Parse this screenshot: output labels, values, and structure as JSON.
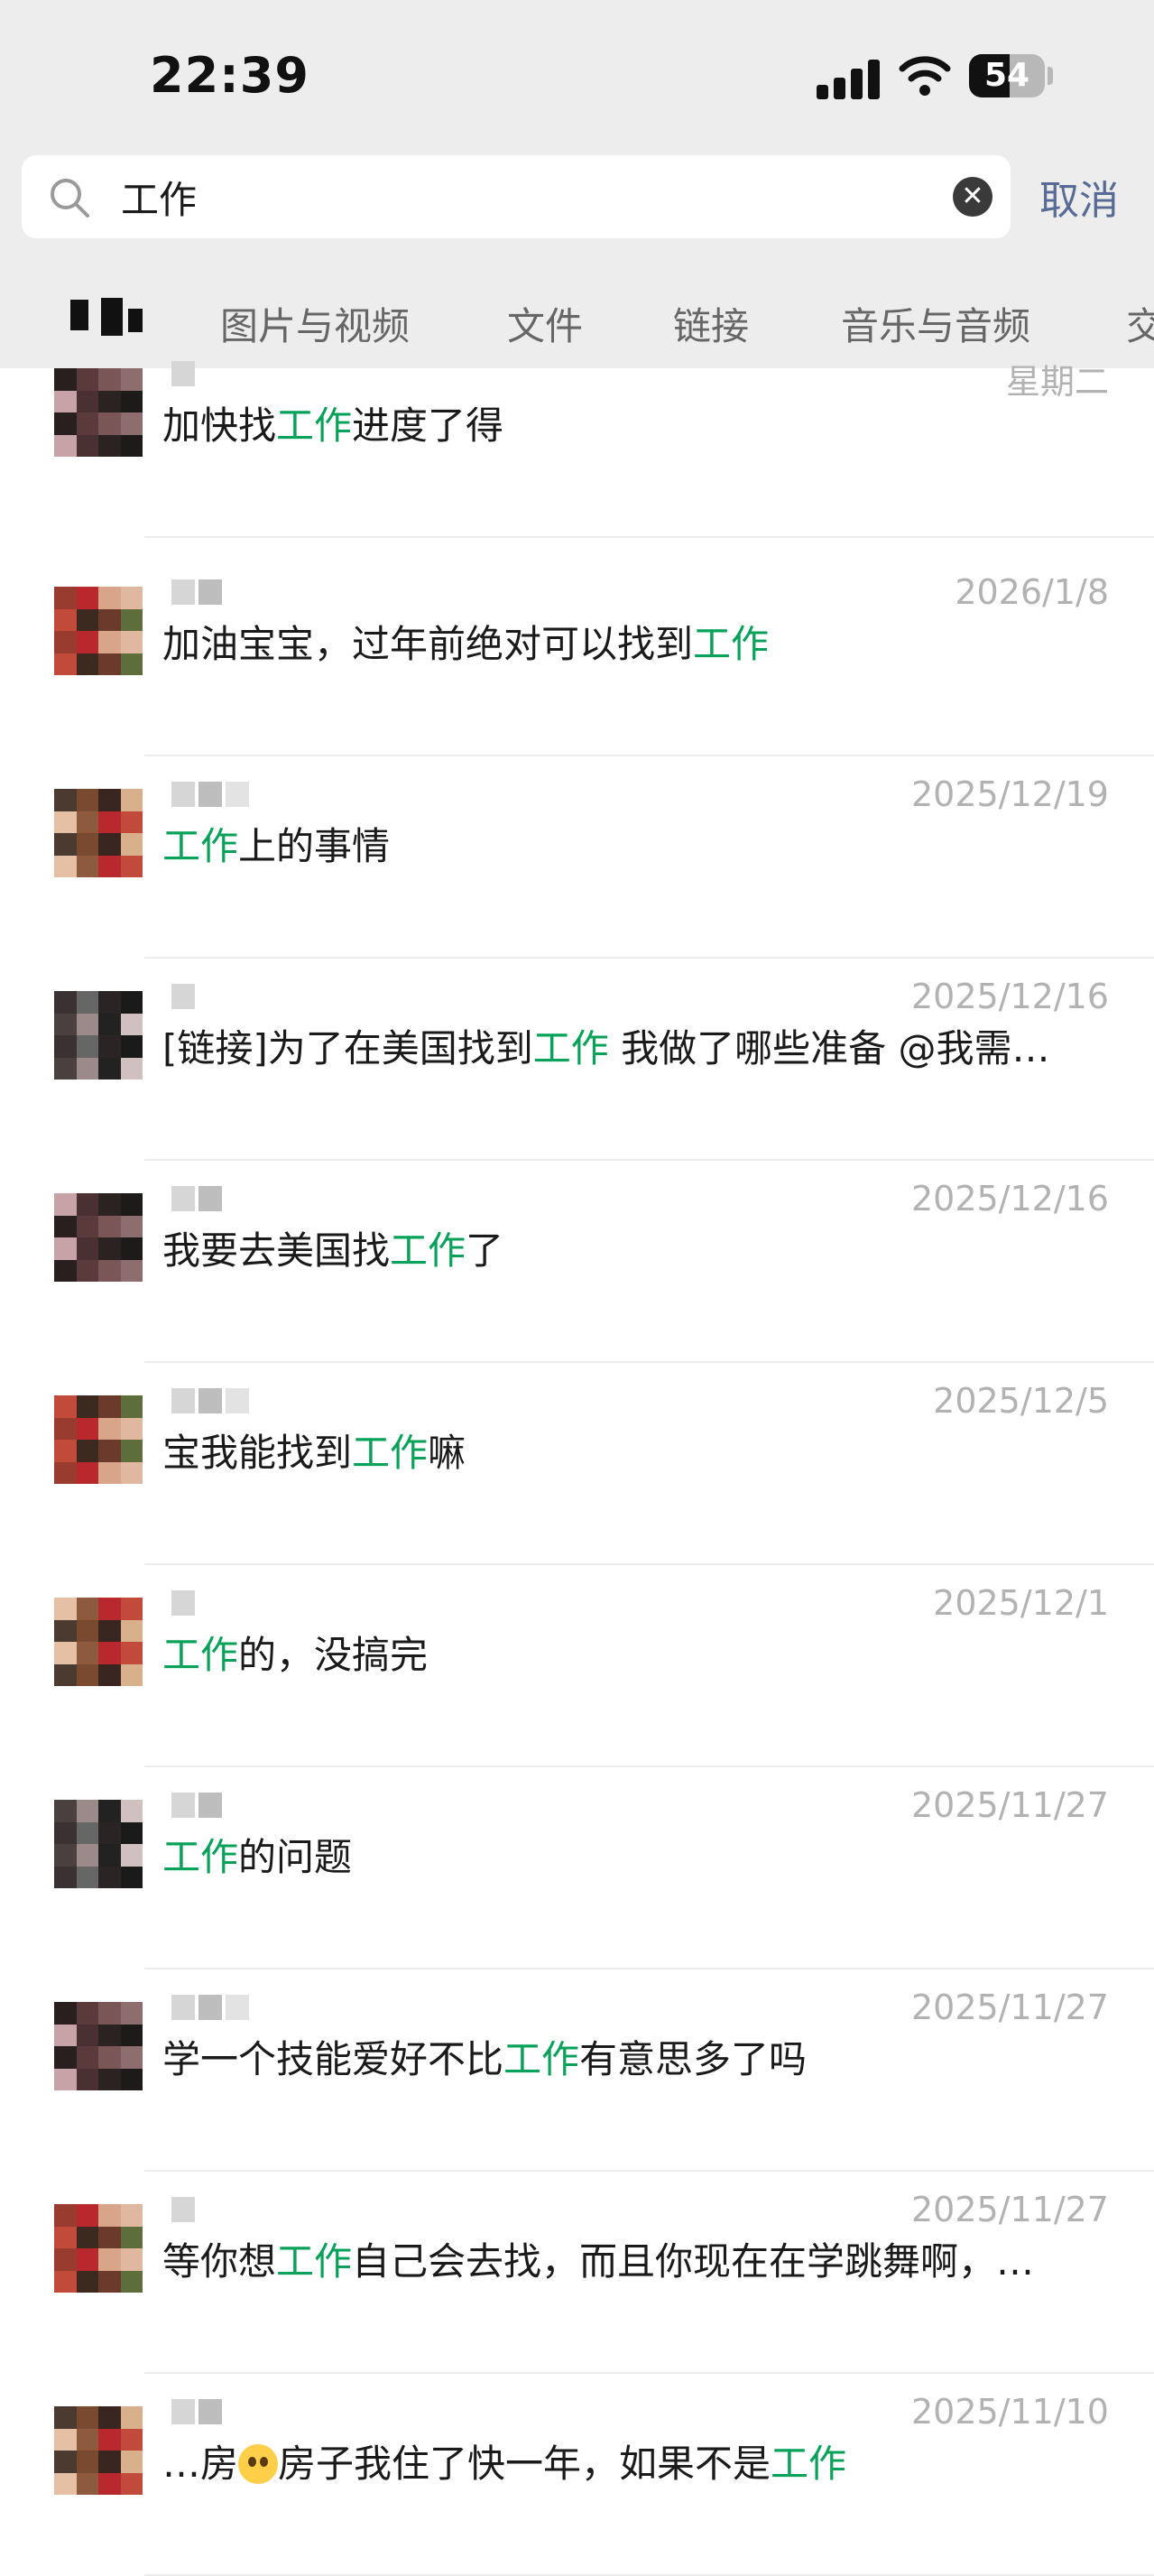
{
  "status_bar": {
    "time": "22:39",
    "battery": "54"
  },
  "search": {
    "query": "工作",
    "cancel_label": "取消"
  },
  "tabs": [
    "图片与视频",
    "文件",
    "链接",
    "音乐与音频",
    "交"
  ],
  "results": [
    {
      "date": "星期二",
      "parts": [
        {
          "t": "加快找"
        },
        {
          "t": "工作",
          "hl": true
        },
        {
          "t": "进度了得"
        }
      ]
    },
    {
      "date": "2026/1/8",
      "parts": [
        {
          "t": "加油宝宝，过年前绝对可以找到"
        },
        {
          "t": "工作",
          "hl": true
        }
      ]
    },
    {
      "date": "2025/12/19",
      "parts": [
        {
          "t": "工作",
          "hl": true
        },
        {
          "t": "上的事情"
        }
      ]
    },
    {
      "date": "2025/12/16",
      "parts": [
        {
          "t": "[链接]为了在美国找到"
        },
        {
          "t": "工作",
          "hl": true
        },
        {
          "t": " 我做了哪些准备 @我需…"
        }
      ]
    },
    {
      "date": "2025/12/16",
      "parts": [
        {
          "t": "我要去美国找"
        },
        {
          "t": "工作",
          "hl": true
        },
        {
          "t": "了"
        }
      ]
    },
    {
      "date": "2025/12/5",
      "parts": [
        {
          "t": "宝我能找到"
        },
        {
          "t": "工作",
          "hl": true
        },
        {
          "t": "嘛"
        }
      ]
    },
    {
      "date": "2025/12/1",
      "parts": [
        {
          "t": "工作",
          "hl": true
        },
        {
          "t": "的，没搞完"
        }
      ]
    },
    {
      "date": "2025/11/27",
      "parts": [
        {
          "t": "工作",
          "hl": true
        },
        {
          "t": "的问题"
        }
      ]
    },
    {
      "date": "2025/11/27",
      "parts": [
        {
          "t": "学一个技能爱好不比"
        },
        {
          "t": "工作",
          "hl": true
        },
        {
          "t": "有意思多了吗"
        }
      ]
    },
    {
      "date": "2025/11/27",
      "parts": [
        {
          "t": "等你想"
        },
        {
          "t": "工作",
          "hl": true
        },
        {
          "t": "自己会去找，而且你现在在学跳舞啊，…"
        }
      ]
    },
    {
      "date": "2025/11/10",
      "parts": [
        {
          "t": "…房"
        },
        {
          "emoji": "pleading-face"
        },
        {
          "t": "房子我住了快一年，如果不是"
        },
        {
          "t": "工作",
          "hl": true
        }
      ]
    }
  ]
}
